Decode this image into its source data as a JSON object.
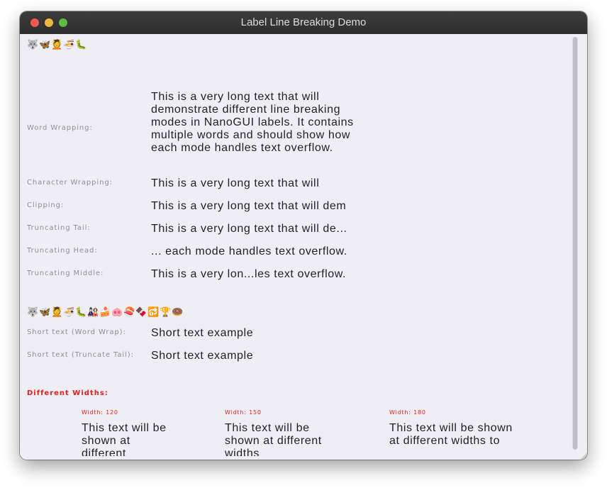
{
  "window": {
    "title": "Label Line Breaking Demo"
  },
  "emoji_rows": {
    "top": [
      "🐺",
      "🦋",
      "💆",
      "🍜",
      "🐛"
    ],
    "middle": [
      "🐺",
      "🦋",
      "💆",
      "🍜",
      "🐛",
      "🎎",
      "🍰",
      "🐽",
      "🍣",
      "🍫",
      "🔂",
      "🏆",
      "🍩"
    ]
  },
  "rows": [
    {
      "label": "Word Wrapping:",
      "text": "This is a very long text that will demonstrate different line breaking modes in NanoGUI labels. It contains multiple words and should show how each mode handles text overflow."
    },
    {
      "label": "Character Wrapping:",
      "text": "This is a very long text that will"
    },
    {
      "label": "Clipping:",
      "text": "This is a very long text that will dem"
    },
    {
      "label": "Truncating Tail:",
      "text": "This is a very long text that will de..."
    },
    {
      "label": "Truncating Head:",
      "text": "... each mode handles text overflow."
    },
    {
      "label": "Truncating Middle:",
      "text": "This is a very lon...les text overflow."
    }
  ],
  "short_rows": [
    {
      "label": "Short text (Word Wrap):",
      "text": "Short text example"
    },
    {
      "label": "Short text (Truncate Tail):",
      "text": "Short text example"
    }
  ],
  "widths_section": {
    "heading": "Different Widths:",
    "columns": [
      {
        "label": "Width: 120",
        "text": "This text will be shown at different"
      },
      {
        "label": "Width: 150",
        "text": "This text will be shown at different widths"
      },
      {
        "label": "Width: 180",
        "text": "This text will be shown at different widths to"
      }
    ]
  },
  "colors": {
    "accent": "#e51c1c",
    "background": "#efeef4",
    "titlebar": "#333333"
  }
}
